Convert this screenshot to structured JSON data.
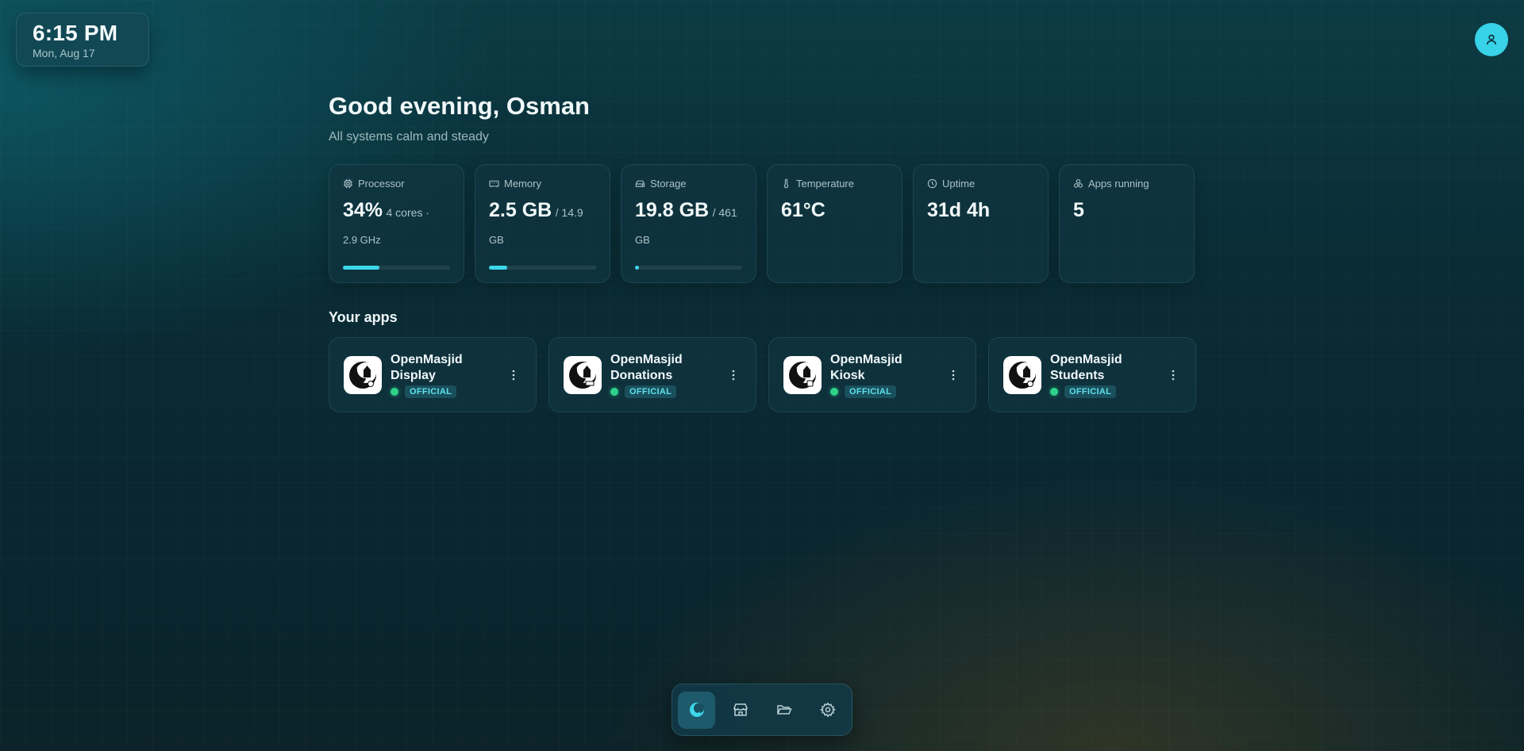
{
  "clock": {
    "time": "6:15 PM",
    "date": "Mon, Aug 17"
  },
  "user": {
    "avatar_icon": "user-icon"
  },
  "greeting": {
    "title": "Good evening, Osman",
    "subtitle": "All systems calm and steady"
  },
  "stats": [
    {
      "label": "Processor",
      "icon": "cpu-icon",
      "value": "34%",
      "detail": "4 cores ·",
      "detail2": "2.9 GHz",
      "progress_percent": 34
    },
    {
      "label": "Memory",
      "icon": "memory-icon",
      "value": "2.5 GB",
      "detail": "/ 14.9",
      "detail2": "GB",
      "progress_percent": 17
    },
    {
      "label": "Storage",
      "icon": "storage-icon",
      "value": "19.8 GB",
      "detail": "/ 461",
      "detail2": "GB",
      "progress_percent": 4
    },
    {
      "label": "Temperature",
      "icon": "thermometer-icon",
      "value": "61°C"
    },
    {
      "label": "Uptime",
      "icon": "clock-icon",
      "value": "31d 4h"
    },
    {
      "label": "Apps running",
      "icon": "apps-icon",
      "value": "5"
    }
  ],
  "apps_section": {
    "title": "Your apps"
  },
  "apps": [
    {
      "name_line1": "OpenMasjid",
      "name_line2": "Display",
      "badge": "OFFICIAL",
      "status": "running"
    },
    {
      "name_line1": "OpenMasjid",
      "name_line2": "Donations",
      "badge": "OFFICIAL",
      "status": "running"
    },
    {
      "name_line1": "OpenMasjid",
      "name_line2": "Kiosk",
      "badge": "OFFICIAL",
      "status": "running"
    },
    {
      "name_line1": "OpenMasjid",
      "name_line2": "Students",
      "badge": "OFFICIAL",
      "status": "running"
    }
  ],
  "dock": {
    "items": [
      {
        "icon": "home-logo-icon",
        "active": true
      },
      {
        "icon": "store-icon",
        "active": false
      },
      {
        "icon": "folder-icon",
        "active": false
      },
      {
        "icon": "settings-gear-icon",
        "active": false
      }
    ]
  },
  "colors": {
    "accent": "#3dd6ea",
    "status_green": "#2fd28a",
    "avatar": "#38d3e8"
  }
}
